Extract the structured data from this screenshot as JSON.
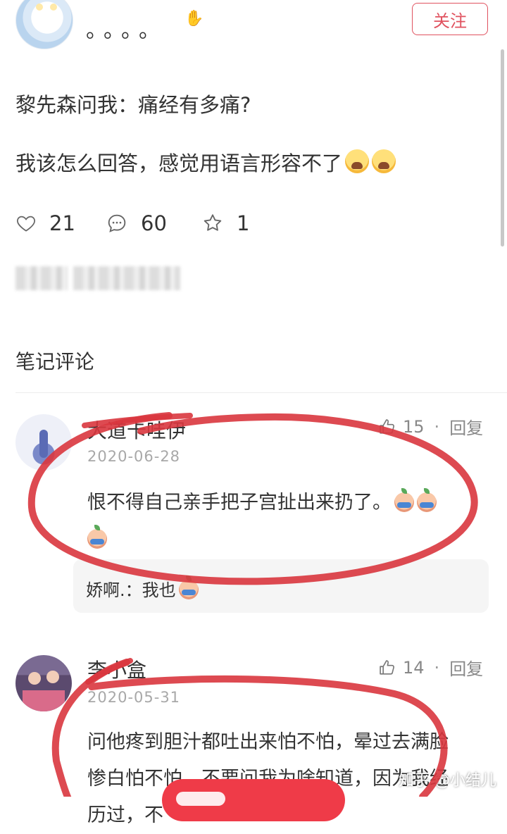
{
  "header": {
    "username": "。。。。",
    "follow_label": "关注",
    "hand_icon": "✋"
  },
  "post": {
    "line1": "黎先森问我：痛经有多痛?",
    "line2": "我该怎么回答，感觉用语言形容不了"
  },
  "stats": {
    "likes": "21",
    "comments": "60",
    "stars": "1"
  },
  "section_title": "笔记评论",
  "comments": [
    {
      "name": "大道卡哇伊",
      "date": "2020-06-28",
      "likes": "15",
      "reply_label": "回复",
      "text": "恨不得自己亲手把子宫扯出来扔了。",
      "reply": "娇啊.：我也"
    },
    {
      "name": "李小盒",
      "date": "2020-05-31",
      "likes": "14",
      "reply_label": "回复",
      "text_line1": "问他疼到胆汁都吐出来怕不怕，晕过去满脸",
      "text_line2": "惨白怕不怕，不要问我为啥知道，因为我经",
      "text_line3": "历过，不"
    }
  ],
  "watermark": "知乎 @小结儿",
  "colors": {
    "accent": "#e0525f",
    "annotation": "#d9363e",
    "button_red": "#ef3b48"
  }
}
